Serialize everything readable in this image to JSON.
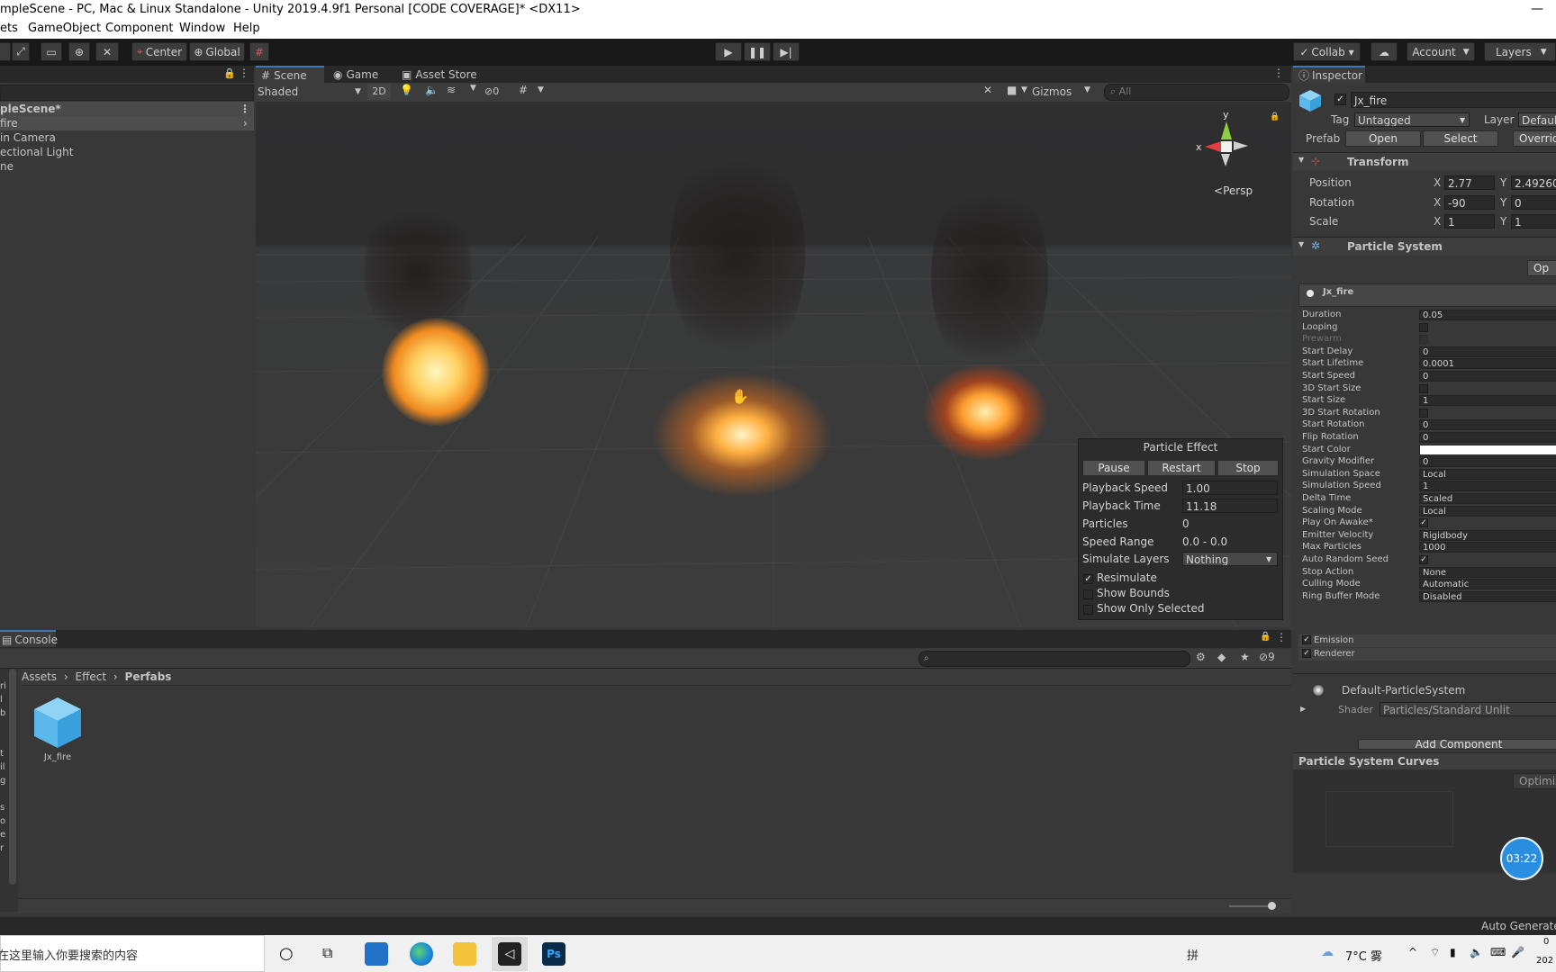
{
  "window": {
    "title": "mpleScene - PC, Mac & Linux Standalone - Unity 2019.4.9f1 Personal [CODE COVERAGE]* <DX11>",
    "minimize_glyph": "—"
  },
  "menu": [
    "ets",
    "GameObject",
    "Component",
    "Window",
    "Help"
  ],
  "toolbar": {
    "pivot_label": "Center",
    "space_label": "Global",
    "collab_label": "Collab ▾",
    "account_label": "Account",
    "layers_label": "Layers"
  },
  "hierarchy": {
    "scene_name": "pleScene*",
    "items": [
      "fire",
      "in Camera",
      "ectional Light",
      "ne"
    ]
  },
  "scene_tabs": {
    "scene": "Scene",
    "game": "Game",
    "asset_store": "Asset Store"
  },
  "scene_toolbar": {
    "shading": "Shaded",
    "mode_2d": "2D",
    "hidden_count": "0",
    "gizmos": "Gizmos",
    "search_placeholder": "All"
  },
  "gizmo": {
    "y": "y",
    "x": "x",
    "persp": "Persp"
  },
  "particle_effect": {
    "title": "Particle Effect",
    "pause": "Pause",
    "restart": "Restart",
    "stop": "Stop",
    "playback_speed_label": "Playback Speed",
    "playback_speed": "1.00",
    "playback_time_label": "Playback Time",
    "playback_time": "11.18",
    "particles_label": "Particles",
    "particles": "0",
    "speed_range_label": "Speed Range",
    "speed_range": "0.0 - 0.0",
    "simulate_layers_label": "Simulate Layers",
    "simulate_layers": "Nothing",
    "resimulate": "Resimulate",
    "show_bounds": "Show Bounds",
    "show_only_selected": "Show Only Selected"
  },
  "inspector": {
    "tab": "Inspector",
    "object_name": "Jx_fire",
    "tag_label": "Tag",
    "tag_value": "Untagged",
    "layer_label": "Layer",
    "layer_value": "Default",
    "prefab_label": "Prefab",
    "open": "Open",
    "select": "Select",
    "overrides": "Overrid",
    "transform": {
      "title": "Transform",
      "position_label": "Position",
      "position_x": "2.77",
      "position_y": "2.49260",
      "rotation_label": "Rotation",
      "rotation_x": "-90",
      "rotation_y": "0",
      "scale_label": "Scale",
      "scale_x": "1",
      "scale_y": "1",
      "x": "X",
      "y": "Y"
    },
    "particle_system": {
      "title": "Particle System",
      "open_editor": "Op",
      "module_name": "Jx_fire",
      "rows": [
        {
          "label": "Duration",
          "value": "0.05",
          "kind": "text"
        },
        {
          "label": "Looping",
          "value": "",
          "kind": "check"
        },
        {
          "label": "Prewarm",
          "value": "",
          "kind": "check-disabled"
        },
        {
          "label": "Start Delay",
          "value": "0",
          "kind": "text"
        },
        {
          "label": "Start Lifetime",
          "value": "0.0001",
          "kind": "text"
        },
        {
          "label": "Start Speed",
          "value": "0",
          "kind": "text"
        },
        {
          "label": "3D Start Size",
          "value": "",
          "kind": "check"
        },
        {
          "label": "Start Size",
          "value": "1",
          "kind": "text"
        },
        {
          "label": "3D Start Rotation",
          "value": "",
          "kind": "check"
        },
        {
          "label": "Start Rotation",
          "value": "0",
          "kind": "text"
        },
        {
          "label": "Flip Rotation",
          "value": "0",
          "kind": "text"
        },
        {
          "label": "Start Color",
          "value": "",
          "kind": "color"
        },
        {
          "label": "Gravity Modifier",
          "value": "0",
          "kind": "text"
        },
        {
          "label": "Simulation Space",
          "value": "Local",
          "kind": "text"
        },
        {
          "label": "Simulation Speed",
          "value": "1",
          "kind": "text"
        },
        {
          "label": "Delta Time",
          "value": "Scaled",
          "kind": "text"
        },
        {
          "label": "Scaling Mode",
          "value": "Local",
          "kind": "text"
        },
        {
          "label": "Play On Awake*",
          "value": "✓",
          "kind": "checked"
        },
        {
          "label": "Emitter Velocity",
          "value": "Rigidbody",
          "kind": "text"
        },
        {
          "label": "Max Particles",
          "value": "1000",
          "kind": "text"
        },
        {
          "label": "Auto Random Seed",
          "value": "✓",
          "kind": "checked"
        },
        {
          "label": "Stop Action",
          "value": "None",
          "kind": "text"
        },
        {
          "label": "Culling Mode",
          "value": "Automatic",
          "kind": "text"
        },
        {
          "label": "Ring Buffer Mode",
          "value": "Disabled",
          "kind": "text"
        }
      ],
      "emission": "Emission",
      "renderer": "Renderer"
    },
    "material": {
      "name": "Default-ParticleSystem",
      "shader_label": "Shader",
      "shader_value": "Particles/Standard Unlit"
    },
    "add_component": "Add Component",
    "curves_title": "Particle System Curves",
    "optimize": "Optimiz",
    "timer": "03:22",
    "auto_generate": "Auto Generate"
  },
  "console": {
    "tab": "Console",
    "breadcrumb": [
      "Assets",
      "Effect",
      "Perfabs"
    ],
    "hidden_count": "9",
    "asset_name": "Jx_fire",
    "left_letters": [
      "ri",
      "l",
      "b",
      "",
      "",
      "t",
      "il",
      "g",
      "",
      "s",
      "o",
      "e",
      "r",
      "",
      "¢"
    ]
  },
  "taskbar": {
    "search_text": "在这里输入你要搜索的内容",
    "weather": "7°C 雾",
    "ime": "拼",
    "year": "202",
    "clock_digit": "0"
  }
}
